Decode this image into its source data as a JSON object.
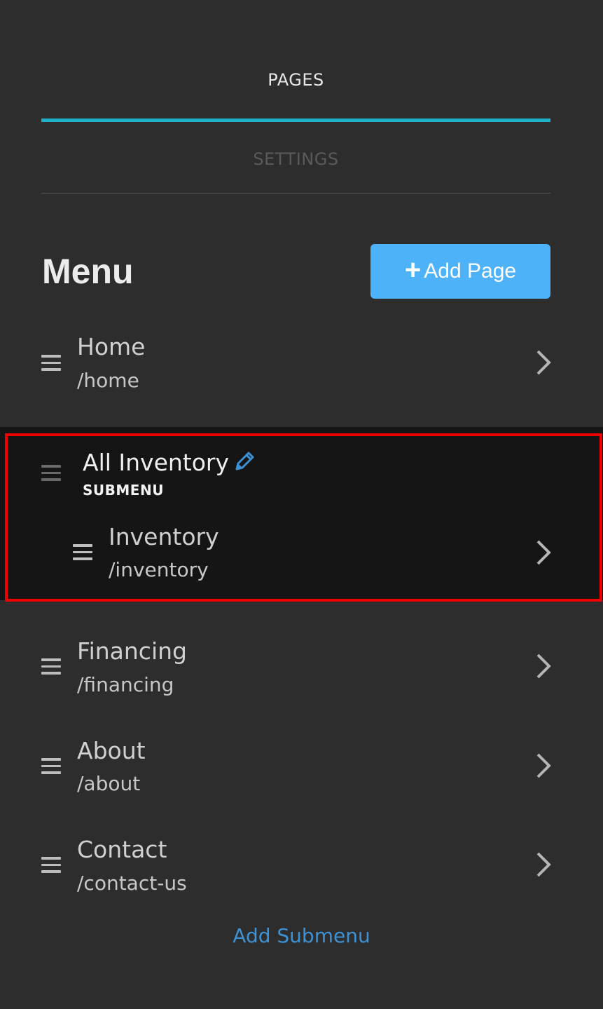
{
  "tabs": {
    "pages_label": "PAGES",
    "settings_label": "SETTINGS"
  },
  "menu": {
    "title": "Menu",
    "add_page_label": "Add Page"
  },
  "items": [
    {
      "name": "Home",
      "path": "/home"
    },
    {
      "name": "Financing",
      "path": "/financing"
    },
    {
      "name": "About",
      "path": "/about"
    },
    {
      "name": "Contact",
      "path": "/contact-us"
    }
  ],
  "submenu": {
    "title": "All Inventory",
    "label": "SUBMENU",
    "children": [
      {
        "name": "Inventory",
        "path": "/inventory"
      }
    ]
  },
  "add_submenu_label": "Add Submenu",
  "colors": {
    "accent": "#1bb3c8",
    "button": "#4db2f7",
    "link": "#3d92d6",
    "highlight": "#ee0000"
  },
  "icons": [
    "drag-handle-icon",
    "chevron-right-icon",
    "pencil-icon",
    "plus-icon"
  ]
}
